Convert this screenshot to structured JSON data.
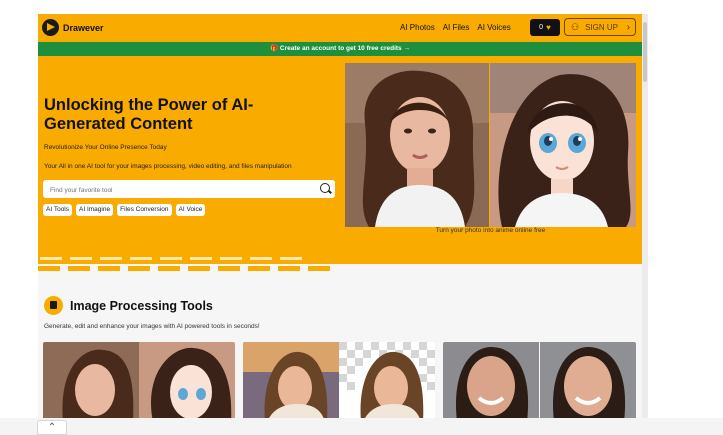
{
  "header": {
    "brand": "Drawever",
    "nav": [
      "AI Photos",
      "AI Files",
      "AI Voices"
    ],
    "credits": "0",
    "signup_label": "SIGN UP"
  },
  "promo": {
    "text": "🎁 Create an account to get 10 free credits →"
  },
  "hero": {
    "title": "Unlocking the Power of AI-Generated Content",
    "subtitle": "Revolutionize Your Online Presence Today",
    "description": "Your All in one AI tool for your images processing, video editing, and files manipulation",
    "search_placeholder": "Find your favorite tool",
    "chips": [
      "AI Tools",
      "AI Imagine",
      "Files Conversion",
      "AI Voice"
    ],
    "slide_caption": "Turn your photo into anime online free",
    "slides_total": 4,
    "active_slide": 2
  },
  "section": {
    "title": "Image Processing Tools",
    "description": "Generate, edit and enhance your images with AI powered tools in seconds!"
  },
  "colors": {
    "brand": "#f9ab00",
    "promo": "#1e8f3c"
  },
  "icons": {
    "logo": "play-circle-icon",
    "user": "user-icon",
    "search": "search-icon",
    "section": "image-tool-icon"
  }
}
